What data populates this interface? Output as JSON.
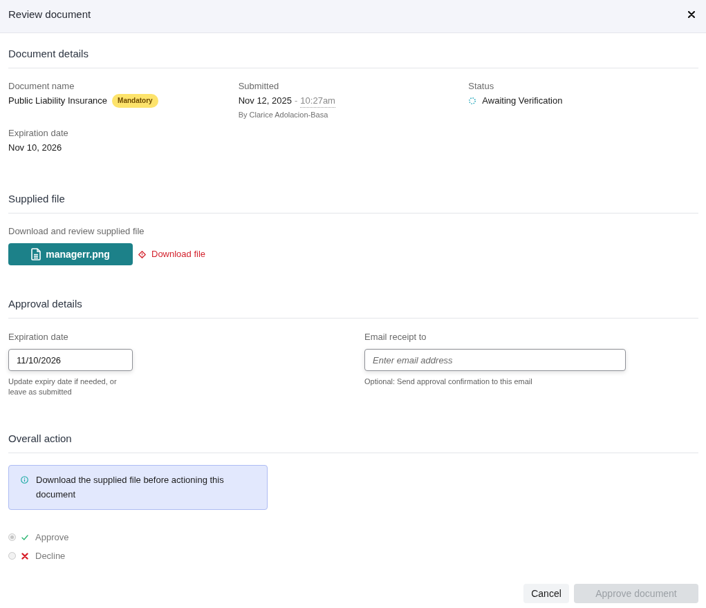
{
  "dialog": {
    "title": "Review document"
  },
  "document_details": {
    "heading": "Document details",
    "document_name": {
      "label": "Document name",
      "value": "Public Liability Insurance",
      "badge": "Mandatory"
    },
    "submitted": {
      "label": "Submitted",
      "date": "Nov 12, 2025",
      "separator": "-",
      "time": "10:27am",
      "by": "By Clarice Adolacion-Basa"
    },
    "status": {
      "label": "Status",
      "value": "Awaiting Verification"
    },
    "expiration": {
      "label": "Expiration date",
      "value": "Nov 10, 2026"
    }
  },
  "supplied_file": {
    "heading": "Supplied file",
    "description": "Download and review supplied file",
    "file_name": "managerr.png",
    "download_link": "Download file"
  },
  "approval_details": {
    "heading": "Approval details",
    "expiration_date": {
      "label": "Expiration date",
      "value": "11/10/2026",
      "hint": "Update expiry date if needed, or leave as submitted"
    },
    "email_receipt": {
      "label": "Email receipt to",
      "placeholder": "Enter email address",
      "hint": "Optional: Send approval confirmation to this email"
    }
  },
  "overall_action": {
    "heading": "Overall action",
    "notice": "Download the supplied file before actioning this document",
    "options": [
      {
        "kind": "approve",
        "label": "Approve",
        "selected": true,
        "disabled": true
      },
      {
        "kind": "decline",
        "label": "Decline",
        "selected": false,
        "disabled": true
      }
    ]
  },
  "footer": {
    "buttons": [
      {
        "kind": "secondary",
        "label": "Cancel",
        "disabled": false
      },
      {
        "kind": "primary",
        "label": "Approve document",
        "disabled": true
      }
    ]
  }
}
